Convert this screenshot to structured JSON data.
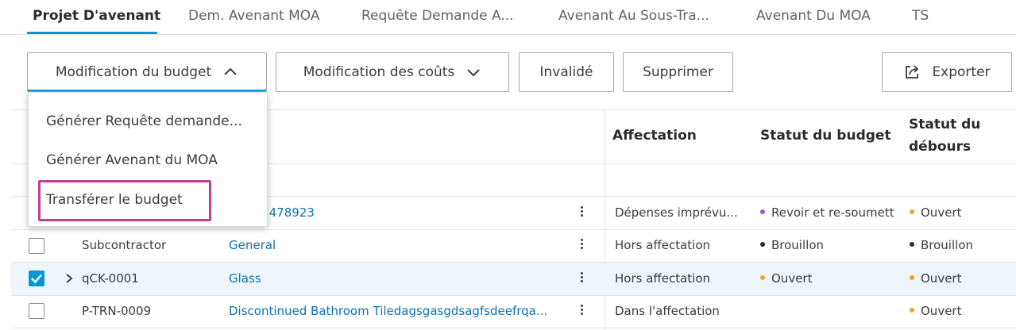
{
  "tabs": [
    {
      "label": "Projet D'avenant",
      "active": true
    },
    {
      "label": "Dem. Avenant MOA"
    },
    {
      "label": "Requête Demande A..."
    },
    {
      "label": "Avenant Au Sous-Tra..."
    },
    {
      "label": "Avenant Du MOA"
    },
    {
      "label": "TS"
    }
  ],
  "toolbar": {
    "budget_change": "Modification du budget",
    "cost_change": "Modification des coûts",
    "invalidate": "Invalidé",
    "delete": "Supprimer",
    "export": "Exporter"
  },
  "dropdown": {
    "items": [
      "Générer Requête demande...",
      "Générer Avenant du MOA",
      "Transférer le budget"
    ]
  },
  "table": {
    "headers": {
      "affectation": "Affectation",
      "budget_status": "Statut du budget",
      "disbursement_status_line1": "Statut du",
      "disbursement_status_line2": "débours"
    },
    "rows": [
      {
        "checked": false,
        "expand": false,
        "type": "",
        "name": "472478923",
        "affectation": "Dépenses imprévu...",
        "budget_status": "Revoir et re-soumett",
        "budget_dot": "#9b59d0",
        "disb_status": "Ouvert",
        "disb_dot": "#f0a030"
      },
      {
        "checked": false,
        "expand": false,
        "type": "Subcontractor",
        "name": "General",
        "affectation": "Hors affectation",
        "budget_status": "Brouillon",
        "budget_dot": "#2b2b2b",
        "disb_status": "Brouillon",
        "disb_dot": "#2b2b2b"
      },
      {
        "checked": true,
        "expand": true,
        "type": "qCK-0001",
        "name": "Glass",
        "affectation": "Hors affectation",
        "budget_status": "Ouvert",
        "budget_dot": "#f0a030",
        "disb_status": "Ouvert",
        "disb_dot": "#f0a030"
      },
      {
        "checked": false,
        "expand": false,
        "type": "P-TRN-0009",
        "name": "Discontinued Bathroom Tiledagsgasgdsagfsdeefrqa...",
        "affectation": "Dans l'affectation",
        "budget_status": "",
        "budget_dot": "",
        "disb_status": "Ouvert",
        "disb_dot": "#f0a030"
      }
    ]
  },
  "colors": {
    "accent": "#0696d7",
    "highlight": "#c0428f",
    "link": "#0a72b5"
  },
  "icons": [
    "chevron-up-icon",
    "chevron-down-icon",
    "export-icon",
    "kebab-icon",
    "expand-chevron-icon",
    "checkmark-icon"
  ]
}
